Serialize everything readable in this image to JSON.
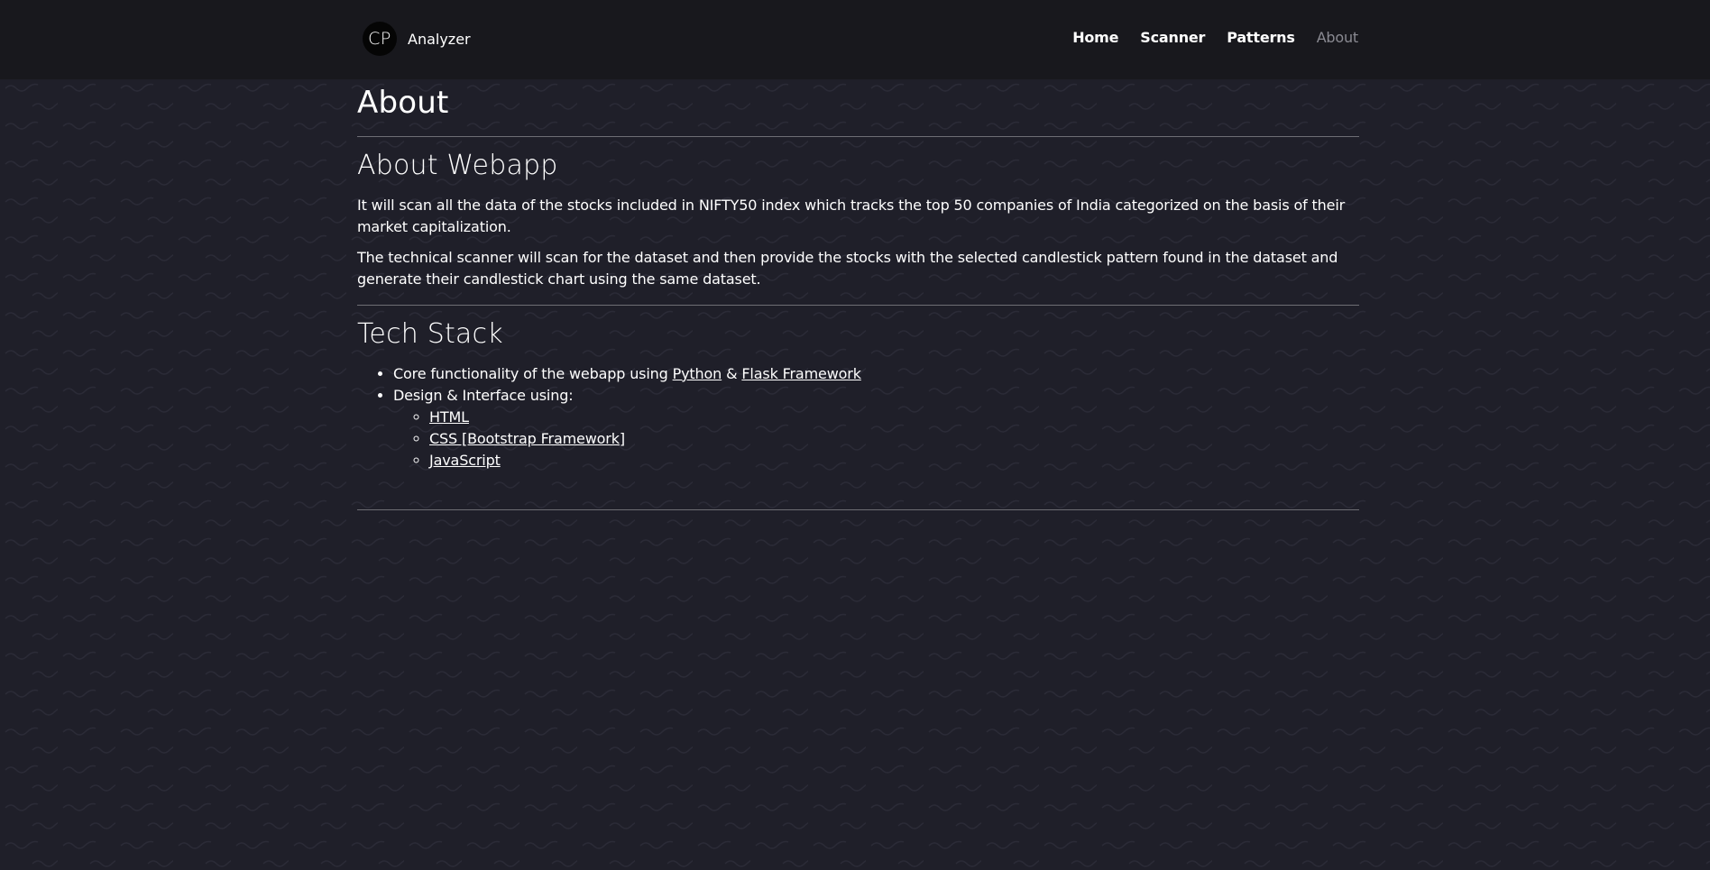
{
  "navbar": {
    "logo_text": "CP",
    "brand_name": "Analyzer",
    "links": [
      {
        "label": "Home"
      },
      {
        "label": "Scanner"
      },
      {
        "label": "Patterns"
      },
      {
        "label": "About"
      }
    ]
  },
  "page": {
    "title": "About",
    "about_section": {
      "heading": "About Webapp",
      "paragraphs": [
        "It will scan all the data of the stocks included in NIFTY50 index which tracks the top 50 companies of India categorized on the basis of their market capitalization.",
        "The technical scanner will scan for the dataset and then provide the stocks with the selected candlestick pattern found in the dataset and generate their candlestick chart using the same dataset."
      ]
    },
    "tech_stack": {
      "heading": "Tech Stack",
      "item1_prefix": "Core functionality of the webapp using ",
      "python_link": "Python",
      "ampersand": " & ",
      "flask_link": "Flask Framework",
      "item2_text": "Design & Interface using:",
      "sub_items": [
        "HTML",
        "CSS [Bootstrap Framework]",
        "JavaScript"
      ]
    }
  },
  "colors": {
    "background": "#1f1f29",
    "navbar": "#18181d",
    "muted_link": "#8a8a92",
    "divider": "#6e6e74"
  }
}
